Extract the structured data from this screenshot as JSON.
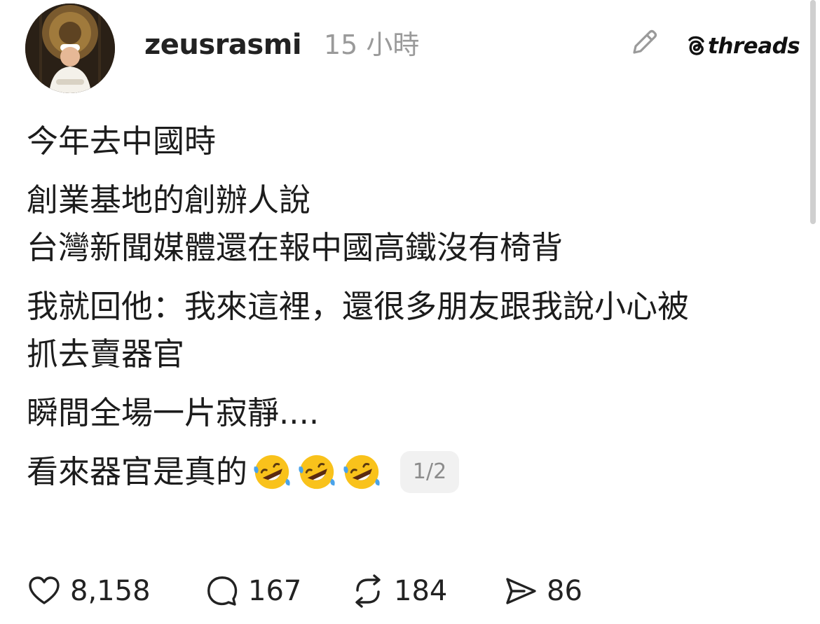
{
  "header": {
    "username": "zeusrasmi",
    "timestamp": "15 小時",
    "brand_name": "threads"
  },
  "post": {
    "paragraphs": [
      [
        "今年去中國時"
      ],
      [
        "創業基地的創辦人說",
        "台灣新聞媒體還在報中國高鐵沒有椅背"
      ],
      [
        "我就回他：我來這裡，還很多朋友跟我說小心被",
        "抓去賣器官"
      ],
      [
        "瞬間全場一片寂靜...."
      ]
    ],
    "last_line": "看來器官是真的",
    "emojis": [
      "rolling-on-floor-laughing",
      "rolling-on-floor-laughing",
      "rolling-on-floor-laughing"
    ],
    "page_indicator": "1/2"
  },
  "actions": {
    "likes": "8,158",
    "replies": "167",
    "reposts": "184",
    "shares": "86"
  },
  "icons": {
    "edit": "pencil-icon",
    "brand": "threads-logo",
    "like": "heart-icon",
    "reply": "speech-bubble-icon",
    "repost": "repost-arrows-icon",
    "share": "send-icon"
  },
  "colors": {
    "text": "#1c1c1c",
    "muted": "#9a9a9a",
    "emoji_face": "#f9c21b",
    "emoji_tear": "#4aa3ea"
  }
}
